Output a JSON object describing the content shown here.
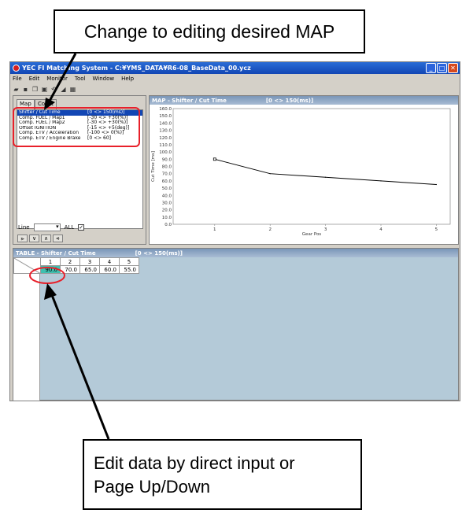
{
  "callouts": {
    "top": "Change to editing desired MAP",
    "bottom_line1": "Edit data by direct input or",
    "bottom_line2": "Page Up/Down"
  },
  "window": {
    "title": "YEC FI Matching System - C:¥YMS_DATA¥R6-08_BaseData_00.ycz",
    "controls": [
      "_",
      "□",
      "✕"
    ]
  },
  "menu": [
    "File",
    "Edit",
    "Monitor",
    "Tool",
    "Window",
    "Help"
  ],
  "left_panel": {
    "tabs": [
      "Map",
      "Const"
    ],
    "maps": [
      {
        "name": "Shifter / Cut Time",
        "range": "[0 <> 150(ms)]",
        "selected": true
      },
      {
        "name": "Comp. FUEL / Map1",
        "range": "[-30 <> +30(%)]",
        "selected": false
      },
      {
        "name": "Comp. FUEL / Map2",
        "range": "[-30 <> +30(%)]",
        "selected": false
      },
      {
        "name": "Offset IGNITION",
        "range": "[-15 <> +5(deg)]",
        "selected": false
      },
      {
        "name": "Comp. ETV / Acceleration",
        "range": "[-100 <> 0(%)]",
        "selected": false
      },
      {
        "name": "Comp. ETV / Engine Brake",
        "range": "[0 <> 60]",
        "selected": false
      }
    ],
    "line_label": "Line",
    "all_label": "ALL",
    "all_checked": "✓",
    "nav_buttons": [
      "⪢",
      "∨",
      "∧",
      "⪡"
    ]
  },
  "graph": {
    "header_title": "MAP - Shifter / Cut Time",
    "header_range": "[0 <> 150(ms)]"
  },
  "chart_data": {
    "type": "line",
    "x": [
      1,
      2,
      3,
      4,
      5
    ],
    "values": [
      90.0,
      70.0,
      65.0,
      60.0,
      55.0
    ],
    "xlabel": "Gear Pos",
    "ylabel": "Cut Time [ms]",
    "ylim": [
      0,
      160
    ],
    "yticks": [
      "160.0",
      "150.0",
      "140.0",
      "130.0",
      "120.0",
      "110.0",
      "100.0",
      "90.0",
      "80.0",
      "70.0",
      "60.0",
      "50.0",
      "40.0",
      "30.0",
      "20.0",
      "10.0",
      "0.0"
    ],
    "xticks": [
      "1",
      "2",
      "3",
      "4",
      "5"
    ],
    "grid": false
  },
  "table": {
    "header_title": "TABLE - Shifter / Cut Time",
    "header_range": "[0 <> 150(ms)]",
    "columns": [
      "1",
      "2",
      "3",
      "4",
      "5"
    ],
    "values": [
      "90.0",
      "70.0",
      "65.0",
      "60.0",
      "55.0"
    ],
    "active_index": 0
  },
  "colors": {
    "highlight": "#e8202a",
    "selected_cell": "#40c0b0",
    "table_bg": "#b4cad8"
  }
}
